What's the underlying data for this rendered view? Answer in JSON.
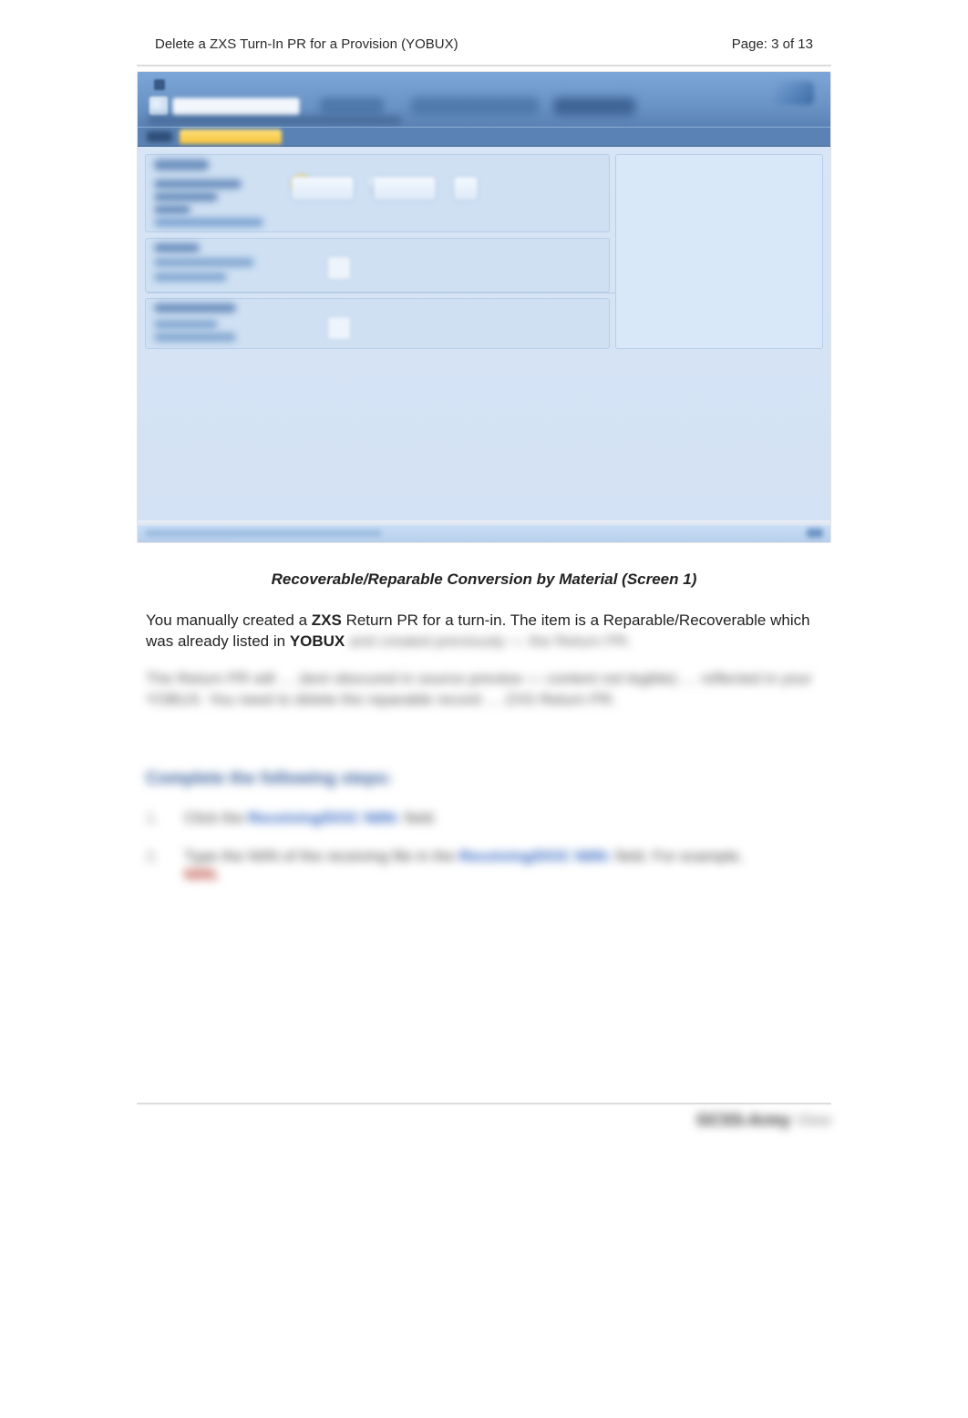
{
  "header": {
    "title_left": "Delete a ZXS Turn-In PR for a Provision (YOBUX)",
    "page_label": "Page: 3 of 13"
  },
  "caption": "Recoverable/Reparable Conversion by Material (Screen 1)",
  "paragraph": {
    "pre1": "You manually created a ",
    "b1": "ZXS",
    "mid1": " Return PR for a turn-in. The item is a Reparable/Recoverable which was already listed in ",
    "b2": "YOBUX",
    "blur_tail": " and created previously — the Return PR."
  },
  "blurred_paragraph": "The Return PR will … (text obscured in source preview — content not legible) … reflected in your YOBUX. You need to delete the reparable record … ZXS Return PR.",
  "section_heading": "Complete the following steps:",
  "steps": [
    {
      "n": "1.",
      "pre": "Click the ",
      "link": "Receiving/DOC NIIN:",
      "post": " field."
    },
    {
      "n": "2.",
      "pre": "Type the NIIN of the receiving file in the ",
      "link": "Receiving/DOC NIIN:",
      "post": " field. For example, ",
      "red": "NIIN."
    }
  ],
  "footer": {
    "brand": "GCSS-Army",
    "suffix": "View"
  }
}
